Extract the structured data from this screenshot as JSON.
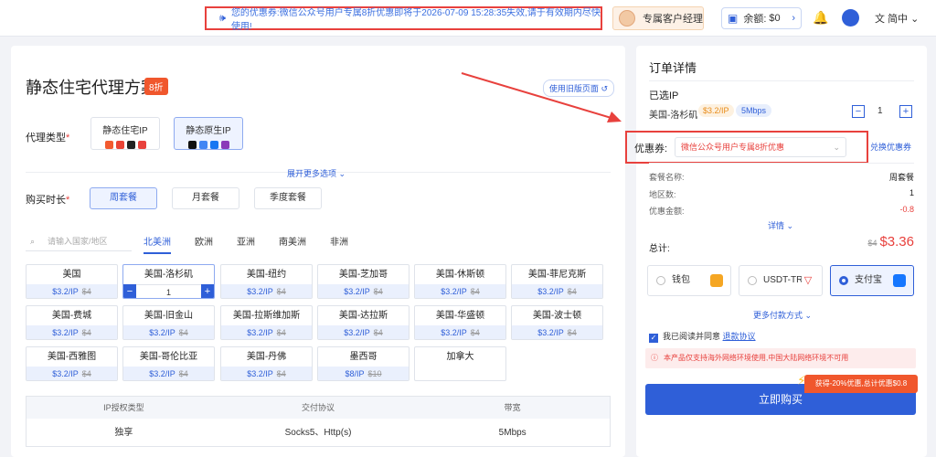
{
  "header": {
    "notice": "您的优惠券:微信公众号用户专属8折优惠即将于2026-07-09 15:28:35失效,请于有效期内尽快使用!",
    "manager": "专属客户经理",
    "balance_label": "余额:",
    "balance_value": "$0",
    "language": "简中"
  },
  "plan": {
    "title": "静态住宅代理方案",
    "badge": "8折",
    "old_version": "使用旧版页面",
    "proxy_type_label": "代理类型",
    "proxy_types": [
      "静态住宅IP",
      "静态原生IP"
    ],
    "expand": "展开更多选项",
    "duration_label": "购买时长",
    "durations": [
      "周套餐",
      "月套餐",
      "季度套餐"
    ],
    "search_placeholder": "请输入国家/地区",
    "regions": [
      "北美洲",
      "欧洲",
      "亚洲",
      "南美洲",
      "非洲"
    ],
    "locations": [
      {
        "name": "美国",
        "price": "$3.2/IP",
        "old": "$4"
      },
      {
        "name": "美国-洛杉矶",
        "price": "",
        "old": "",
        "qty": "1"
      },
      {
        "name": "美国-纽约",
        "price": "$3.2/IP",
        "old": "$4"
      },
      {
        "name": "美国-芝加哥",
        "price": "$3.2/IP",
        "old": "$4"
      },
      {
        "name": "美国-休斯顿",
        "price": "$3.2/IP",
        "old": "$4"
      },
      {
        "name": "美国-菲尼克斯",
        "price": "$3.2/IP",
        "old": "$4"
      },
      {
        "name": "美国-费城",
        "price": "$3.2/IP",
        "old": "$4"
      },
      {
        "name": "美国-旧金山",
        "price": "$3.2/IP",
        "old": "$4"
      },
      {
        "name": "美国-拉斯维加斯",
        "price": "$3.2/IP",
        "old": "$4"
      },
      {
        "name": "美国-达拉斯",
        "price": "$3.2/IP",
        "old": "$4"
      },
      {
        "name": "美国-华盛顿",
        "price": "$3.2/IP",
        "old": "$4"
      },
      {
        "name": "美国-波士顿",
        "price": "$3.2/IP",
        "old": "$4"
      },
      {
        "name": "美国-西雅图",
        "price": "$3.2/IP",
        "old": "$4"
      },
      {
        "name": "美国-哥伦比亚",
        "price": "$3.2/IP",
        "old": "$4"
      },
      {
        "name": "美国-丹佛",
        "price": "$3.2/IP",
        "old": "$4"
      },
      {
        "name": "墨西哥",
        "price": "$8/IP",
        "old": "$10"
      },
      {
        "name": "加拿大",
        "price": "",
        "old": ""
      }
    ],
    "spec_headers": [
      "IP授权类型",
      "交付协议",
      "带宽"
    ],
    "spec_values": [
      "独享",
      "Socks5、Http(s)",
      "5Mbps"
    ]
  },
  "order": {
    "title": "订单详情",
    "selected_ip": "已选IP",
    "location": "美国-洛杉矶",
    "tag_price": "$3.2/IP",
    "tag_bw": "5Mbps",
    "qty": "1",
    "coupon_label": "优惠券:",
    "coupon_value": "微信公众号用户专属8折优惠",
    "coupon_swap": "兑换优惠券",
    "pkg_name_label": "套餐名称:",
    "pkg_name": "周套餐",
    "region_count_label": "地区数:",
    "region_count": "1",
    "discount_label": "优惠金额:",
    "discount": "-0.8",
    "detail": "详情",
    "total_label": "总计:",
    "total_old": "$4",
    "total": "$3.36",
    "payments": [
      "钱包",
      "USDT-TRX",
      "支付宝"
    ],
    "more_pay": "更多付款方式",
    "agree_text": "我已阅读并同意",
    "agree_link": "退款协议",
    "warning": "本产品仅支持海外网络环境使用,中国大陆网络环境不可用",
    "promo": "获得-20%优惠,总计优惠$0.8",
    "buy": "立即购买"
  },
  "colors": {
    "accent": "#2f5fd8",
    "red": "#e8413d",
    "orange": "#f0572d"
  }
}
